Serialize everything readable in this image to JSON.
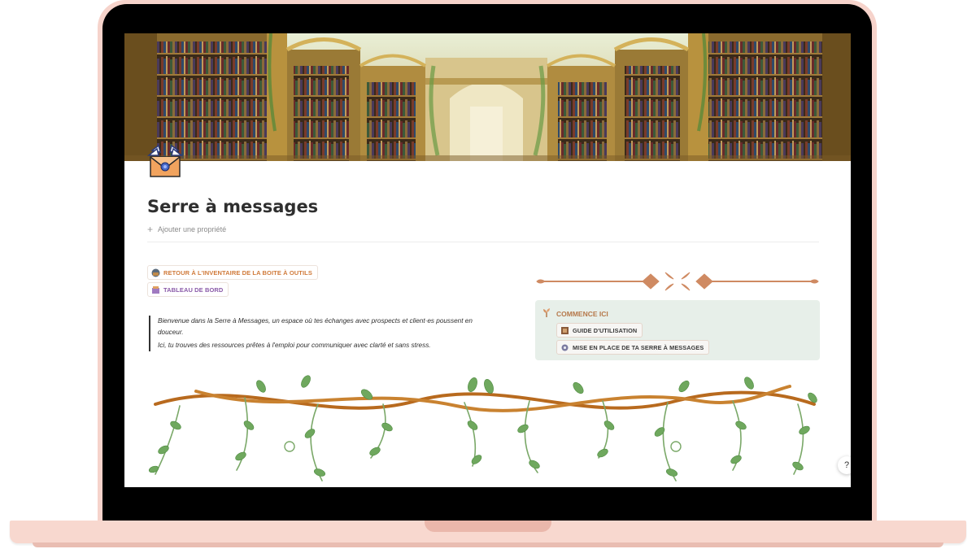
{
  "page": {
    "title": "Serre à messages",
    "add_property": "Ajouter une propriété",
    "icon": "winged-envelope-icon"
  },
  "links": {
    "retour_label": "RETOUR À L'INVENTAIRE DE LA BOITE À OUTILS",
    "retour_icon": "toolbox-icon",
    "tableau_label": "TABLEAU DE BORD",
    "tableau_icon": "dashboard-icon"
  },
  "intro": {
    "line1": "Bienvenue dans la Serre à Messages, un espace où tes échanges avec prospects et client·es poussent en douceur.",
    "line2": "Ici, tu trouves des ressources prêtes à l'emploi pour communiquer avec clarté et sans stress."
  },
  "callout": {
    "icon": "sprout-icon",
    "title": "COMMENCE ICI",
    "guide_label": "GUIDE D'UTILISATION",
    "guide_icon": "book-icon",
    "setup_label": "MISE EN PLACE DE TA SERRE À MESSAGES",
    "setup_icon": "gear-icon"
  },
  "help": {
    "icon": "help-icon"
  },
  "colors": {
    "laptop_frame": "#f6d3cb",
    "link_orange": "#d07a3a",
    "link_purple": "#8a5aa8",
    "callout_bg": "#e7efe9",
    "ornament": "#cf8a62",
    "vine_brown": "#b86a1e",
    "leaf_green": "#6fa85e"
  }
}
